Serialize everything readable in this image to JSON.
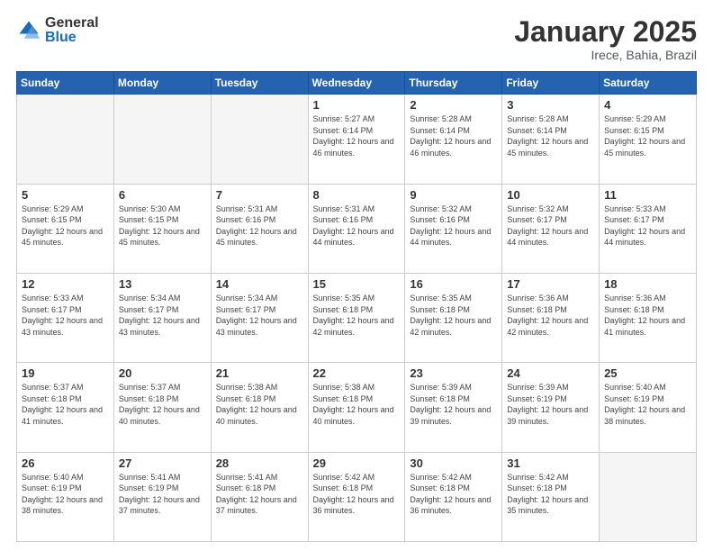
{
  "header": {
    "logo_general": "General",
    "logo_blue": "Blue",
    "month_title": "January 2025",
    "subtitle": "Irece, Bahia, Brazil"
  },
  "days_of_week": [
    "Sunday",
    "Monday",
    "Tuesday",
    "Wednesday",
    "Thursday",
    "Friday",
    "Saturday"
  ],
  "weeks": [
    [
      {
        "day": "",
        "info": ""
      },
      {
        "day": "",
        "info": ""
      },
      {
        "day": "",
        "info": ""
      },
      {
        "day": "1",
        "info": "Sunrise: 5:27 AM\nSunset: 6:14 PM\nDaylight: 12 hours and 46 minutes."
      },
      {
        "day": "2",
        "info": "Sunrise: 5:28 AM\nSunset: 6:14 PM\nDaylight: 12 hours and 46 minutes."
      },
      {
        "day": "3",
        "info": "Sunrise: 5:28 AM\nSunset: 6:14 PM\nDaylight: 12 hours and 45 minutes."
      },
      {
        "day": "4",
        "info": "Sunrise: 5:29 AM\nSunset: 6:15 PM\nDaylight: 12 hours and 45 minutes."
      }
    ],
    [
      {
        "day": "5",
        "info": "Sunrise: 5:29 AM\nSunset: 6:15 PM\nDaylight: 12 hours and 45 minutes."
      },
      {
        "day": "6",
        "info": "Sunrise: 5:30 AM\nSunset: 6:15 PM\nDaylight: 12 hours and 45 minutes."
      },
      {
        "day": "7",
        "info": "Sunrise: 5:31 AM\nSunset: 6:16 PM\nDaylight: 12 hours and 45 minutes."
      },
      {
        "day": "8",
        "info": "Sunrise: 5:31 AM\nSunset: 6:16 PM\nDaylight: 12 hours and 44 minutes."
      },
      {
        "day": "9",
        "info": "Sunrise: 5:32 AM\nSunset: 6:16 PM\nDaylight: 12 hours and 44 minutes."
      },
      {
        "day": "10",
        "info": "Sunrise: 5:32 AM\nSunset: 6:17 PM\nDaylight: 12 hours and 44 minutes."
      },
      {
        "day": "11",
        "info": "Sunrise: 5:33 AM\nSunset: 6:17 PM\nDaylight: 12 hours and 44 minutes."
      }
    ],
    [
      {
        "day": "12",
        "info": "Sunrise: 5:33 AM\nSunset: 6:17 PM\nDaylight: 12 hours and 43 minutes."
      },
      {
        "day": "13",
        "info": "Sunrise: 5:34 AM\nSunset: 6:17 PM\nDaylight: 12 hours and 43 minutes."
      },
      {
        "day": "14",
        "info": "Sunrise: 5:34 AM\nSunset: 6:17 PM\nDaylight: 12 hours and 43 minutes."
      },
      {
        "day": "15",
        "info": "Sunrise: 5:35 AM\nSunset: 6:18 PM\nDaylight: 12 hours and 42 minutes."
      },
      {
        "day": "16",
        "info": "Sunrise: 5:35 AM\nSunset: 6:18 PM\nDaylight: 12 hours and 42 minutes."
      },
      {
        "day": "17",
        "info": "Sunrise: 5:36 AM\nSunset: 6:18 PM\nDaylight: 12 hours and 42 minutes."
      },
      {
        "day": "18",
        "info": "Sunrise: 5:36 AM\nSunset: 6:18 PM\nDaylight: 12 hours and 41 minutes."
      }
    ],
    [
      {
        "day": "19",
        "info": "Sunrise: 5:37 AM\nSunset: 6:18 PM\nDaylight: 12 hours and 41 minutes."
      },
      {
        "day": "20",
        "info": "Sunrise: 5:37 AM\nSunset: 6:18 PM\nDaylight: 12 hours and 40 minutes."
      },
      {
        "day": "21",
        "info": "Sunrise: 5:38 AM\nSunset: 6:18 PM\nDaylight: 12 hours and 40 minutes."
      },
      {
        "day": "22",
        "info": "Sunrise: 5:38 AM\nSunset: 6:18 PM\nDaylight: 12 hours and 40 minutes."
      },
      {
        "day": "23",
        "info": "Sunrise: 5:39 AM\nSunset: 6:18 PM\nDaylight: 12 hours and 39 minutes."
      },
      {
        "day": "24",
        "info": "Sunrise: 5:39 AM\nSunset: 6:19 PM\nDaylight: 12 hours and 39 minutes."
      },
      {
        "day": "25",
        "info": "Sunrise: 5:40 AM\nSunset: 6:19 PM\nDaylight: 12 hours and 38 minutes."
      }
    ],
    [
      {
        "day": "26",
        "info": "Sunrise: 5:40 AM\nSunset: 6:19 PM\nDaylight: 12 hours and 38 minutes."
      },
      {
        "day": "27",
        "info": "Sunrise: 5:41 AM\nSunset: 6:19 PM\nDaylight: 12 hours and 37 minutes."
      },
      {
        "day": "28",
        "info": "Sunrise: 5:41 AM\nSunset: 6:18 PM\nDaylight: 12 hours and 37 minutes."
      },
      {
        "day": "29",
        "info": "Sunrise: 5:42 AM\nSunset: 6:18 PM\nDaylight: 12 hours and 36 minutes."
      },
      {
        "day": "30",
        "info": "Sunrise: 5:42 AM\nSunset: 6:18 PM\nDaylight: 12 hours and 36 minutes."
      },
      {
        "day": "31",
        "info": "Sunrise: 5:42 AM\nSunset: 6:18 PM\nDaylight: 12 hours and 35 minutes."
      },
      {
        "day": "",
        "info": ""
      }
    ]
  ]
}
